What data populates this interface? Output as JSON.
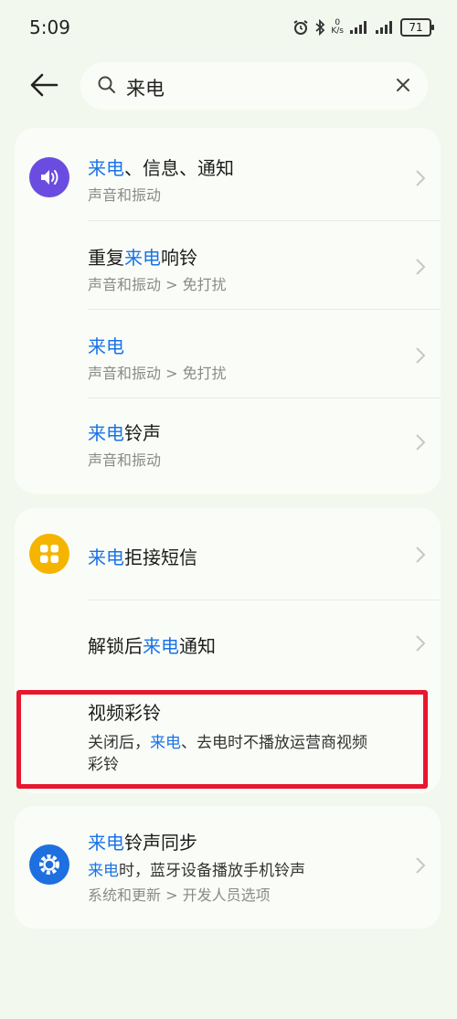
{
  "status": {
    "time": "5:09",
    "net_speed_value": "0",
    "net_speed_unit": "K/s",
    "battery": "71"
  },
  "search": {
    "query": "来电"
  },
  "results": [
    {
      "title_parts": [
        "来电",
        "、信息、通知"
      ],
      "path": "声音和振动"
    },
    {
      "title_parts": [
        "重复",
        "来电",
        "响铃"
      ],
      "path": "声音和振动 > 免打扰"
    },
    {
      "title_parts": [
        "来电"
      ],
      "path": "声音和振动 > 免打扰"
    },
    {
      "title_parts": [
        "来电",
        "铃声"
      ],
      "path": "声音和振动"
    },
    {
      "title_parts": [
        "来电",
        "拒接短信"
      ]
    },
    {
      "title_parts": [
        "解锁后",
        "来电",
        "通知"
      ]
    },
    {
      "title": "视频彩铃",
      "desc_parts": [
        "关闭后，",
        "来电",
        "、去电时不播放运营商视频"
      ],
      "desc_line2": "彩铃"
    },
    {
      "title_parts": [
        "来电",
        "铃声同步"
      ],
      "desc_parts": [
        "来电",
        "时，蓝牙设备播放手机铃声"
      ],
      "path": "系统和更新 > 开发人员选项"
    }
  ],
  "colors": {
    "highlight": "#1a73e8",
    "sound_icon": "#6a4de0",
    "apps_icon": "#f5b400",
    "settings_icon": "#1e6fe0",
    "annotation_box": "#e8162e",
    "background": "#f3f8ee"
  },
  "icons": [
    "alarm-icon",
    "bluetooth-icon",
    "signal-icon",
    "battery-icon",
    "back-arrow-icon",
    "search-icon",
    "close-icon",
    "sound-icon",
    "apps-icon",
    "gear-icon",
    "chevron-right-icon"
  ]
}
